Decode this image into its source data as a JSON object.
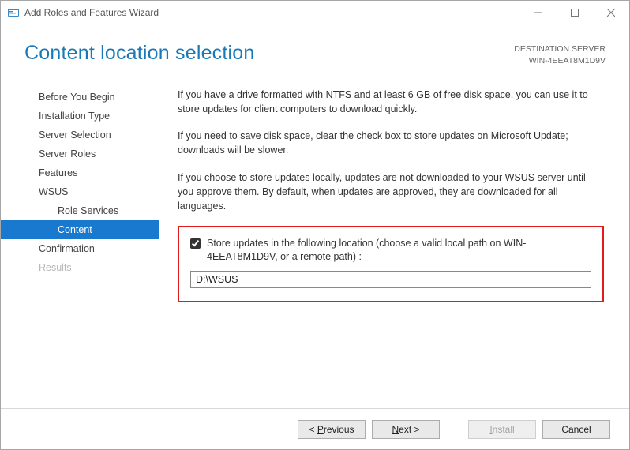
{
  "window": {
    "title": "Add Roles and Features Wizard"
  },
  "header": {
    "page_title": "Content location selection",
    "dest_label": "DESTINATION SERVER",
    "dest_server": "WIN-4EEAT8M1D9V"
  },
  "sidebar": {
    "items": [
      {
        "label": "Before You Begin",
        "indent": false,
        "selected": false,
        "disabled": false
      },
      {
        "label": "Installation Type",
        "indent": false,
        "selected": false,
        "disabled": false
      },
      {
        "label": "Server Selection",
        "indent": false,
        "selected": false,
        "disabled": false
      },
      {
        "label": "Server Roles",
        "indent": false,
        "selected": false,
        "disabled": false
      },
      {
        "label": "Features",
        "indent": false,
        "selected": false,
        "disabled": false
      },
      {
        "label": "WSUS",
        "indent": false,
        "selected": false,
        "disabled": false
      },
      {
        "label": "Role Services",
        "indent": true,
        "selected": false,
        "disabled": false
      },
      {
        "label": "Content",
        "indent": true,
        "selected": true,
        "disabled": false
      },
      {
        "label": "Confirmation",
        "indent": false,
        "selected": false,
        "disabled": false
      },
      {
        "label": "Results",
        "indent": false,
        "selected": false,
        "disabled": true
      }
    ]
  },
  "content": {
    "para1": "If you have a drive formatted with NTFS and at least 6 GB of free disk space, you can use it to store updates for client computers to download quickly.",
    "para2": "If you need to save disk space, clear the check box to store updates on Microsoft Update; downloads will be slower.",
    "para3": "If you choose to store updates locally, updates are not downloaded to your WSUS server until you approve them. By default, when updates are approved, they are downloaded for all languages.",
    "checkbox_label": "Store updates in the following location (choose a valid local path on WIN-4EEAT8M1D9V, or a remote path) :",
    "checkbox_checked": true,
    "path_value": "D:\\WSUS"
  },
  "footer": {
    "previous": "< Previous",
    "next": "Next >",
    "install": "Install",
    "cancel": "Cancel"
  }
}
